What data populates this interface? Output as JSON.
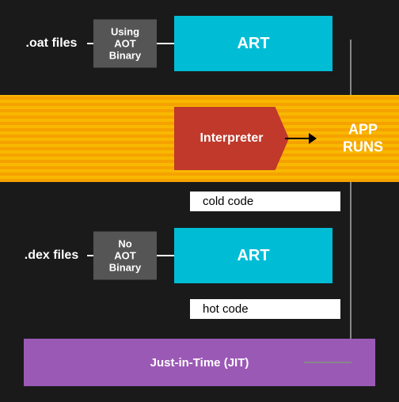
{
  "diagram": {
    "oat_label": ".oat files",
    "aot_binary_label": "Using\nAOT\nBinary",
    "art_top_label": "ART",
    "interpreter_label": "Interpreter",
    "app_runs_line1": "APP",
    "app_runs_line2": "RUNS",
    "cold_code_label": "cold code",
    "dex_label": ".dex files",
    "no_aot_label": "No\nAOT\nBinary",
    "art_bot_label": "ART",
    "hot_code_label": "hot code",
    "jit_label": "Just-in-Time (JIT)",
    "bg_color": "#1a1a1a",
    "art_color": "#00bcd4",
    "interpreter_color": "#c0392b",
    "stripes_color": "#f5a200",
    "jit_color": "#9b59b6",
    "box_color": "#555"
  }
}
